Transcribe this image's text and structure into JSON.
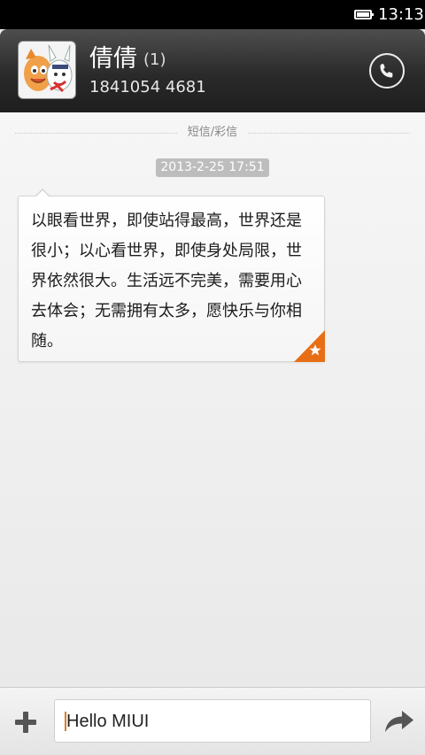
{
  "status_bar": {
    "time": "13:13",
    "icons": [
      "battery-icon"
    ]
  },
  "contact": {
    "name": "倩倩",
    "unread_count": "(1)",
    "number": "1841054 4681",
    "avatar": "contact-avatar",
    "call_icon": "phone-icon"
  },
  "conversation": {
    "separator_label": "短信/彩信",
    "timestamp": "2013-2-25 17:51",
    "message": "以眼看世界，即使站得最高，世界还是很小；以心看世界，即使身处局限，世界依然很大。生活远不完美，需要用心去体会；无需拥有太多，愿快乐与你相随。",
    "badge_icon": "star-icon"
  },
  "composer": {
    "add_icon": "plus-icon",
    "input_value": "Hello MIUI",
    "send_icon": "forward-arrow-icon"
  },
  "colors": {
    "header_bg": "#2a2a2a",
    "accent": "#e86e16",
    "timestamp_bg": "#bdbdbd",
    "background": "#ebebeb"
  }
}
